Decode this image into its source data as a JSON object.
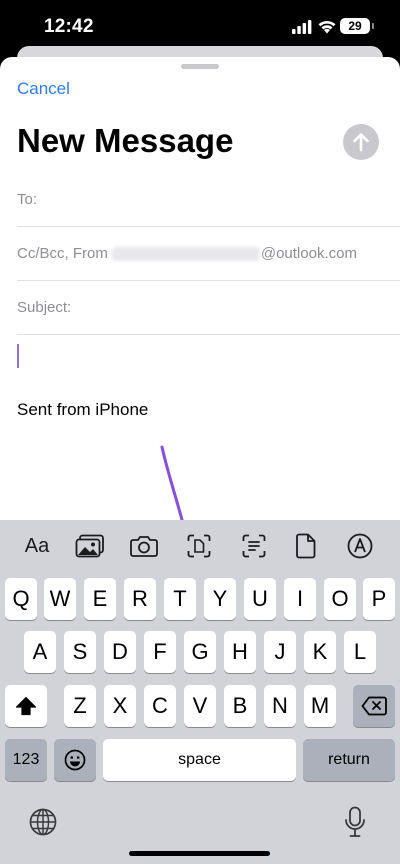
{
  "status_bar": {
    "time": "12:42",
    "battery_level": "29",
    "icons": [
      "signal-icon",
      "wifi-icon",
      "battery-icon"
    ]
  },
  "compose": {
    "cancel_label": "Cancel",
    "title": "New Message",
    "send_icon": "arrow-up-icon",
    "to_label": "To:",
    "ccbcc_label": "Cc/Bcc, From",
    "from_domain": "@outlook.com",
    "subject_label": "Subject:",
    "signature": "Sent from iPhone",
    "accent_color": "#2f7bf6",
    "annotation_arrow_color": "#8a4fe0"
  },
  "format_bar": {
    "text_format_label": "Aa",
    "icons": [
      "photo-library-icon",
      "camera-icon",
      "scan-document-icon",
      "scan-text-icon",
      "attach-file-icon",
      "markup-icon"
    ]
  },
  "keyboard": {
    "row1": [
      "Q",
      "W",
      "E",
      "R",
      "T",
      "Y",
      "U",
      "I",
      "O",
      "P"
    ],
    "row2": [
      "A",
      "S",
      "D",
      "F",
      "G",
      "H",
      "J",
      "K",
      "L"
    ],
    "row3": [
      "Z",
      "X",
      "C",
      "V",
      "B",
      "N",
      "M"
    ],
    "numbers_label": "123",
    "space_label": "space",
    "return_label": "return",
    "icons": [
      "shift-icon",
      "delete-icon",
      "emoji-icon",
      "globe-icon",
      "microphone-icon"
    ]
  }
}
